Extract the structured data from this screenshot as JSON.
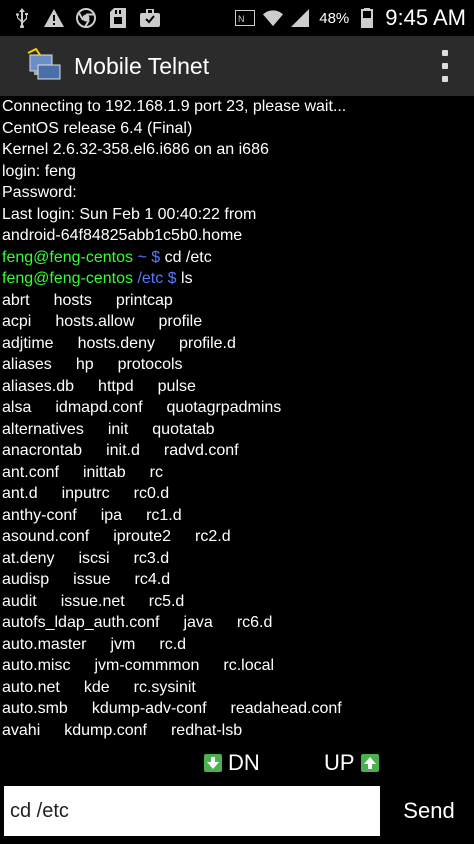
{
  "status_bar": {
    "time": "9:45 AM",
    "battery_pct": "48%",
    "icons": [
      "usb-icon",
      "warning-icon",
      "chrome-icon",
      "sd-card-icon",
      "briefcase-icon",
      "nfc-icon",
      "wifi-icon",
      "signal-icon",
      "battery-icon"
    ]
  },
  "app": {
    "title": "Mobile Telnet"
  },
  "terminal": {
    "lines": [
      "Connecting to 192.168.1.9 port 23, please wait...",
      "CentOS release 6.4 (Final)",
      "Kernel 2.6.32-358.el6.i686 on an i686",
      "login: feng",
      "Password:",
      "Last login: Sun Feb 1 00:40:22 from",
      "android-64f84825abb1c5b0.home"
    ],
    "prompt1": {
      "user": "feng@feng-centos",
      "path": " ~ $",
      "cmd": " cd /etc"
    },
    "prompt2": {
      "user": "feng@feng-centos",
      "path": " /etc $",
      "cmd": " ls"
    },
    "ls_rows": [
      [
        "abrt",
        "hosts",
        "printcap"
      ],
      [
        "acpi",
        "hosts.allow",
        "profile"
      ],
      [
        "adjtime",
        "hosts.deny",
        "profile.d"
      ],
      [
        "aliases",
        "hp",
        "protocols"
      ],
      [
        "aliases.db",
        "httpd",
        "pulse"
      ],
      [
        "alsa",
        "idmapd.conf",
        "quotagrpadmins"
      ],
      [
        "alternatives",
        "init",
        "quotatab"
      ],
      [
        "anacrontab",
        "init.d",
        "radvd.conf"
      ],
      [
        "ant.conf",
        "inittab",
        "rc"
      ],
      [
        "ant.d",
        "inputrc",
        "rc0.d"
      ],
      [
        "anthy-conf",
        "ipa",
        "rc1.d"
      ],
      [
        "asound.conf",
        "iproute2",
        "rc2.d"
      ],
      [
        "at.deny",
        "iscsi",
        "rc3.d"
      ],
      [
        "audisp",
        "issue",
        "rc4.d"
      ],
      [
        "audit",
        "issue.net",
        "rc5.d"
      ],
      [
        "autofs_ldap_auth.conf",
        "java",
        "rc6.d"
      ],
      [
        "auto.master",
        "jvm",
        "rc.d"
      ],
      [
        "auto.misc",
        "jvm-commmon",
        "rc.local"
      ],
      [
        "auto.net",
        "kde",
        "rc.sysinit"
      ],
      [
        "auto.smb",
        "kdump-adv-conf",
        "readahead.conf"
      ],
      [
        "avahi",
        "kdump.conf",
        "redhat-lsb"
      ]
    ]
  },
  "controls": {
    "dn_label": "DN",
    "up_label": "UP"
  },
  "input": {
    "value": "cd /etc",
    "send_label": "Send"
  },
  "colors": {
    "prompt_user": "#33ff33",
    "prompt_path": "#5577ff",
    "action_bar": "#2b2b2b",
    "arrow_button": "#4caf50"
  }
}
